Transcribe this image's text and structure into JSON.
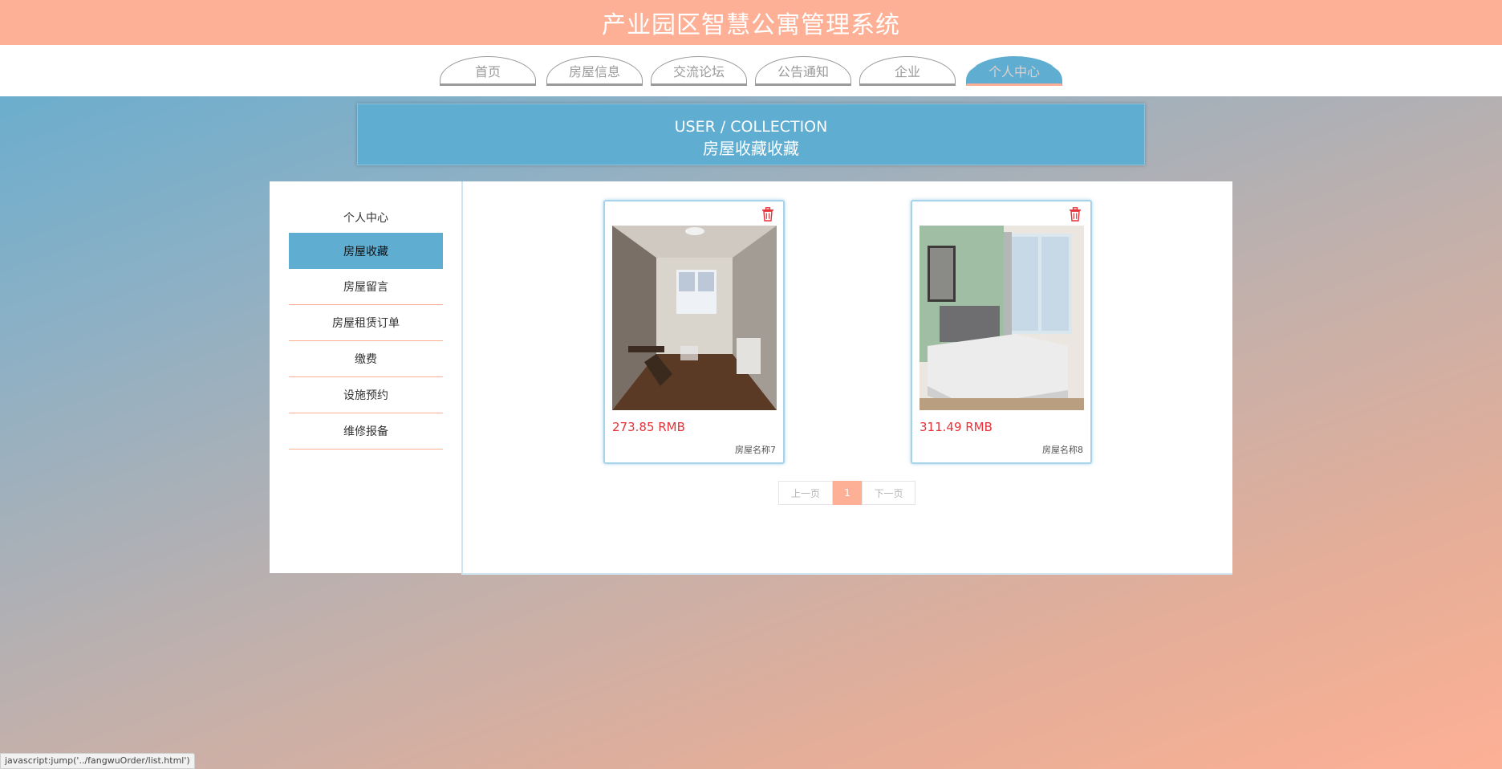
{
  "app": {
    "title": "产业园区智慧公寓管理系统"
  },
  "nav": {
    "tabs": [
      {
        "label": "首页"
      },
      {
        "label": "房屋信息"
      },
      {
        "label": "交流论坛"
      },
      {
        "label": "公告通知"
      },
      {
        "label": "企业"
      },
      {
        "label": "个人中心",
        "active": true
      }
    ]
  },
  "header": {
    "en": "USER / COLLECTION",
    "cn": "房屋收藏收藏"
  },
  "sidebar": {
    "items": [
      {
        "label": "个人中心"
      },
      {
        "label": "房屋收藏",
        "active": true
      },
      {
        "label": "房屋留言"
      },
      {
        "label": "房屋租赁订单"
      },
      {
        "label": "缴费"
      },
      {
        "label": "设施预约"
      },
      {
        "label": "维修报备"
      }
    ]
  },
  "cards": [
    {
      "price": "273.85 RMB",
      "name": "房屋名称7",
      "icon": "trash-icon"
    },
    {
      "price": "311.49 RMB",
      "name": "房屋名称8",
      "icon": "trash-icon"
    }
  ],
  "pager": {
    "prev": "上一页",
    "current": "1",
    "next": "下一页"
  },
  "status": {
    "url": "javascript:jump('../fangwuOrder/list.html')"
  },
  "colors": {
    "accent_blue": "#5fadd1",
    "accent_peach": "#fdb095",
    "price_red": "#e6333a"
  }
}
